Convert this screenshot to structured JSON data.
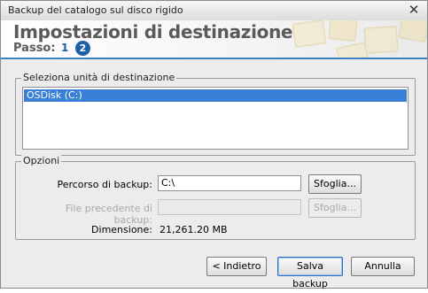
{
  "window": {
    "title": "Backup del catalogo sul disco rigido"
  },
  "header": {
    "title": "Impostazioni di destinazione",
    "step_label": "Passo:",
    "step_1": "1",
    "step_2": "2"
  },
  "destination": {
    "legend": "Seleziona unità di destinazione",
    "drives": [
      "OSDisk (C:)"
    ],
    "selected_index": 0
  },
  "options": {
    "legend": "Opzioni",
    "backup_path_label": "Percorso di backup:",
    "backup_path_value": "C:\\",
    "browse_label": "Sfoglia...",
    "previous_file_label": "File precedente di backup:",
    "previous_file_value": "",
    "browse_previous_label": "Sfoglia...",
    "size_label": "Dimensione:",
    "size_value": "21,261.20 MB"
  },
  "footer": {
    "back_label": "< Indietro",
    "save_label": "Salva backup",
    "cancel_label": "Annulla"
  }
}
